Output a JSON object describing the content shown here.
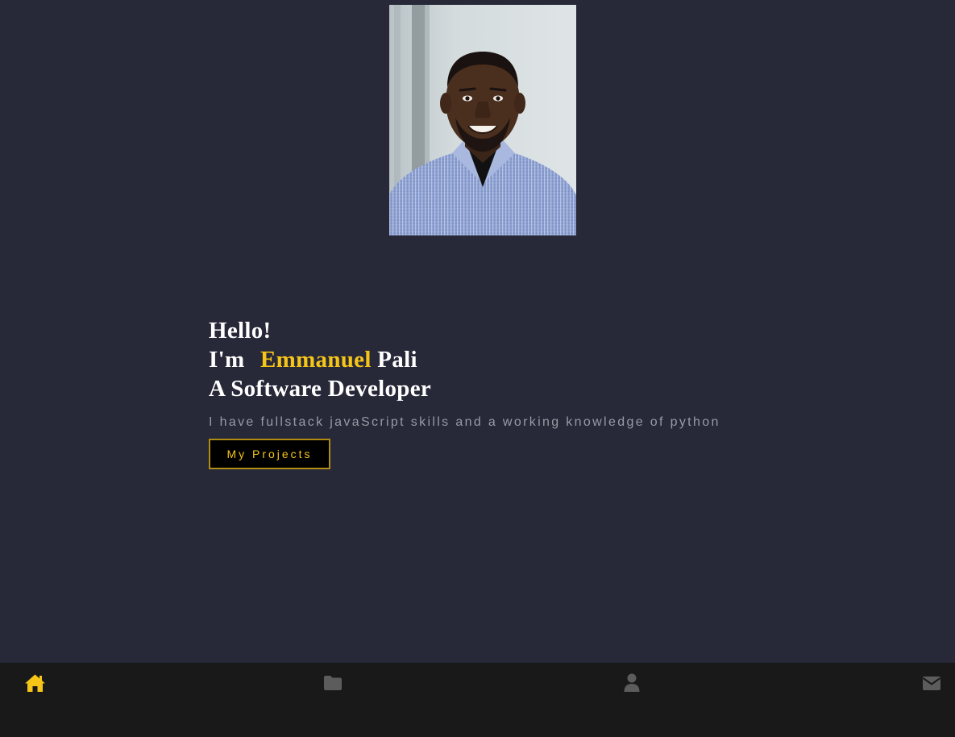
{
  "hero": {
    "greeting": "Hello!",
    "intro_prefix": "I'm",
    "first_name": "Emmanuel",
    "last_name": "Pali",
    "role": "A Software Developer",
    "tagline": "I have fullstack javaScript skills and a working knowledge of python",
    "cta_label": "My Projects"
  },
  "nav": {
    "items": [
      {
        "icon": "home-icon",
        "active": true
      },
      {
        "icon": "folder-icon",
        "active": false
      },
      {
        "icon": "user-icon",
        "active": false
      },
      {
        "icon": "envelope-icon",
        "active": false
      }
    ]
  },
  "colors": {
    "background": "#272838",
    "accent": "#f5c518",
    "nav_background": "#191919",
    "nav_inactive": "#5c5c5c",
    "tagline": "#9a9aa4"
  }
}
